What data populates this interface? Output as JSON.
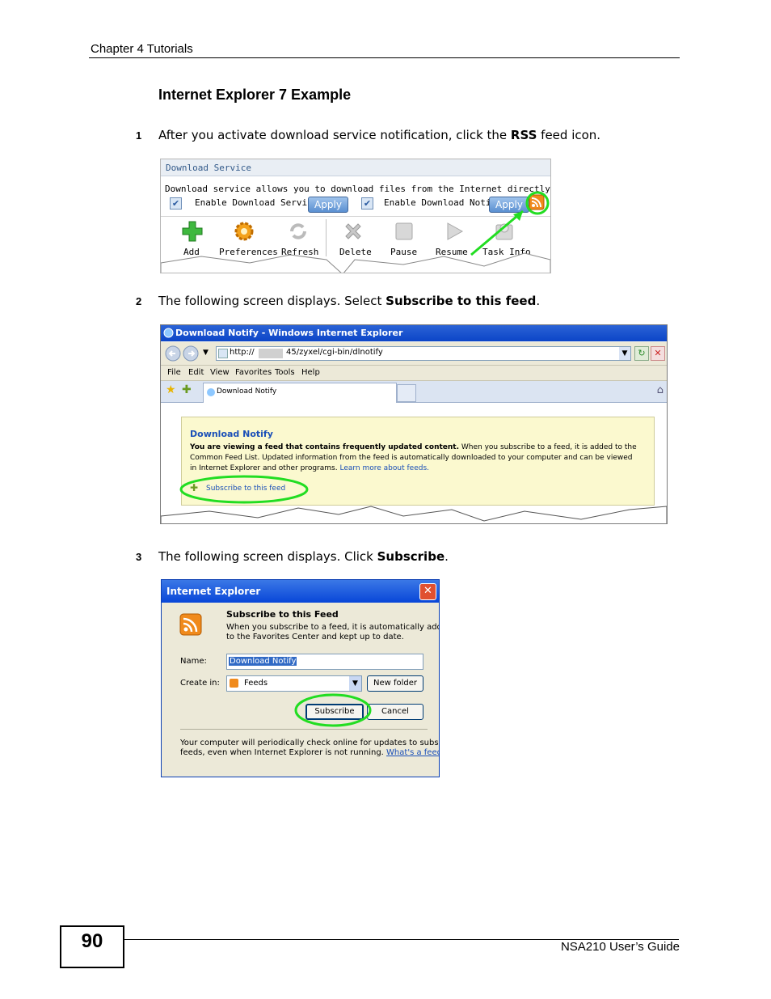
{
  "header": {
    "chapter": "Chapter 4 Tutorials"
  },
  "section_title": "Internet Explorer 7 Example",
  "steps": [
    {
      "num": "1",
      "pre": "After you activate download service notification, click the ",
      "bold": "RSS",
      "post": " feed icon."
    },
    {
      "num": "2",
      "pre": "The following screen displays. Select ",
      "bold": "Subscribe to this feed",
      "post": "."
    },
    {
      "num": "3",
      "pre": "The following screen displays. Click ",
      "bold": "Subscribe",
      "post": "."
    }
  ],
  "shot1": {
    "title": "Download Service",
    "description": "Download service allows you to download files from the Internet directly to the NSA",
    "enable_service_label": "Enable Download Service",
    "enable_notify_label": "Enable Download Notify",
    "apply_label": "Apply",
    "toolbar": [
      "Add",
      "Preferences",
      "Refresh",
      "Delete",
      "Pause",
      "Resume",
      "Task Info"
    ]
  },
  "shot2": {
    "window_title": "Download Notify - Windows Internet Explorer",
    "url_prefix": "http://",
    "url_suffix": "45/zyxel/cgi-bin/dlnotify",
    "menu": [
      "File",
      "Edit",
      "View",
      "Favorites",
      "Tools",
      "Help"
    ],
    "tab_label": "Download Notify",
    "box_heading": "Download Notify",
    "box_bold": "You are viewing a feed that contains frequently updated content.",
    "box_text1": " When you subscribe to a feed, it is added to the",
    "box_text2": "Common Feed List. Updated information from the feed is automatically downloaded to your computer and can be viewed",
    "box_text3": "in Internet Explorer and other programs. ",
    "box_link": "Learn more about feeds.",
    "subscribe_link": "Subscribe to this feed"
  },
  "shot3": {
    "window_title": "Internet Explorer",
    "heading": "Subscribe to this Feed",
    "desc1": "When you subscribe to a feed, it is automatically added",
    "desc2": "to the Favorites Center and kept up to date.",
    "name_label": "Name:",
    "name_value": "Download Notify",
    "create_label": "Create in:",
    "create_value": "Feeds",
    "new_folder": "New folder",
    "subscribe": "Subscribe",
    "cancel": "Cancel",
    "note1": "Your computer will periodically check online for updates to subscribed",
    "note2": "feeds, even when Internet Explorer is not running. ",
    "note_link": "What's a feed?"
  },
  "footer": {
    "page_number": "90",
    "guide": "NSA210 User’s Guide"
  },
  "colors": {
    "highlight": "#22dd22",
    "rss": "#f08a1c",
    "link": "#1a4fb8"
  }
}
